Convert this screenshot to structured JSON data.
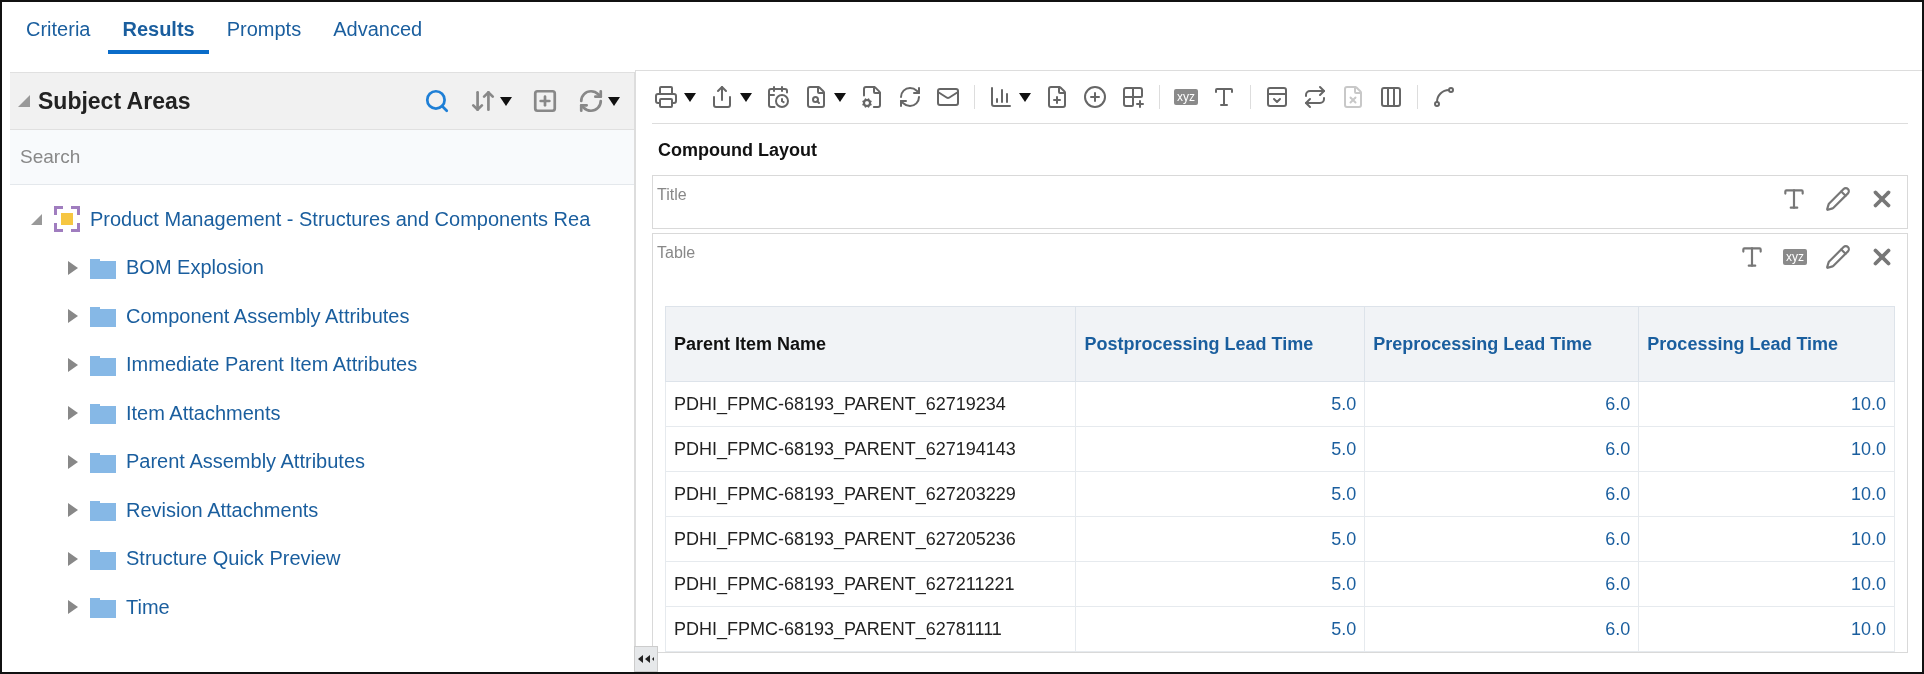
{
  "tabs": [
    {
      "label": "Criteria",
      "selected": false
    },
    {
      "label": "Results",
      "selected": true
    },
    {
      "label": "Prompts",
      "selected": false
    },
    {
      "label": "Advanced",
      "selected": false
    }
  ],
  "subject_areas": {
    "title": "Subject Areas",
    "expanded": true,
    "tools": [
      {
        "kind": "search",
        "dropdown": false
      },
      {
        "kind": "sort",
        "dropdown": true
      },
      {
        "kind": "add",
        "dropdown": false
      },
      {
        "kind": "refresh",
        "dropdown": true
      }
    ],
    "search": {
      "placeholder": "Search"
    },
    "tree": [
      {
        "label": "Product Management - Structures and Components Rea",
        "expanded": true,
        "children": [
          {
            "label": "BOM Explosion",
            "expanded": false
          },
          {
            "label": "Component Assembly Attributes",
            "expanded": false
          },
          {
            "label": "Immediate Parent Item Attributes",
            "expanded": false
          },
          {
            "label": "Item Attachments",
            "expanded": false
          },
          {
            "label": "Parent Assembly Attributes",
            "expanded": false
          },
          {
            "label": "Revision Attachments",
            "expanded": false
          },
          {
            "label": "Structure Quick Preview",
            "expanded": false
          },
          {
            "label": "Time",
            "expanded": false
          }
        ]
      }
    ]
  },
  "toolbar": [
    [
      {
        "kind": "print",
        "dropdown": true,
        "disabled": false
      },
      {
        "kind": "export",
        "dropdown": true,
        "disabled": false
      },
      {
        "kind": "schedule",
        "dropdown": false,
        "disabled": false
      },
      {
        "kind": "preview",
        "dropdown": true,
        "disabled": false
      },
      {
        "kind": "settings",
        "dropdown": false,
        "disabled": false
      },
      {
        "kind": "refresh",
        "dropdown": false,
        "disabled": false
      },
      {
        "kind": "mail",
        "dropdown": false,
        "disabled": false
      }
    ],
    [
      {
        "kind": "chart",
        "dropdown": true,
        "disabled": false
      },
      {
        "kind": "add-doc",
        "dropdown": false,
        "disabled": false
      },
      {
        "kind": "add-circle",
        "dropdown": false,
        "disabled": false
      },
      {
        "kind": "add-table",
        "dropdown": false,
        "disabled": false
      }
    ],
    [
      {
        "kind": "text",
        "label": "xyz",
        "dropdown": false,
        "disabled": false
      },
      {
        "kind": "format",
        "dropdown": false,
        "disabled": false
      }
    ],
    [
      {
        "kind": "add-layout",
        "dropdown": false,
        "disabled": false
      },
      {
        "kind": "swap",
        "dropdown": false,
        "disabled": false
      },
      {
        "kind": "delete",
        "dropdown": false,
        "disabled": true
      },
      {
        "kind": "columns",
        "dropdown": false,
        "disabled": false
      }
    ],
    [
      {
        "kind": "path",
        "dropdown": false,
        "disabled": false
      }
    ]
  ],
  "layout_title": "Compound Layout",
  "views": [
    {
      "label": "Title",
      "actions": [
        {
          "kind": "format"
        },
        {
          "kind": "edit"
        },
        {
          "kind": "remove"
        }
      ]
    },
    {
      "label": "Table",
      "actions": [
        {
          "kind": "format"
        },
        {
          "kind": "text",
          "label": "xyz"
        },
        {
          "kind": "edit"
        },
        {
          "kind": "remove"
        }
      ],
      "table": {
        "columns": [
          {
            "label": "Parent Item Name",
            "kind": "text"
          },
          {
            "label": "Postprocessing Lead Time",
            "kind": "number"
          },
          {
            "label": "Preprocessing Lead Time",
            "kind": "number"
          },
          {
            "label": "Processing Lead Time",
            "kind": "number"
          }
        ],
        "rows": [
          [
            "PDHI_FPMC-68193_PARENT_62719234",
            "5.0",
            "6.0",
            "10.0"
          ],
          [
            "PDHI_FPMC-68193_PARENT_627194143",
            "5.0",
            "6.0",
            "10.0"
          ],
          [
            "PDHI_FPMC-68193_PARENT_627203229",
            "5.0",
            "6.0",
            "10.0"
          ],
          [
            "PDHI_FPMC-68193_PARENT_627205236",
            "5.0",
            "6.0",
            "10.0"
          ],
          [
            "PDHI_FPMC-68193_PARENT_627211221",
            "5.0",
            "6.0",
            "10.0"
          ],
          [
            "PDHI_FPMC-68193_PARENT_62781111",
            "5.0",
            "6.0",
            "10.0"
          ]
        ]
      }
    }
  ]
}
